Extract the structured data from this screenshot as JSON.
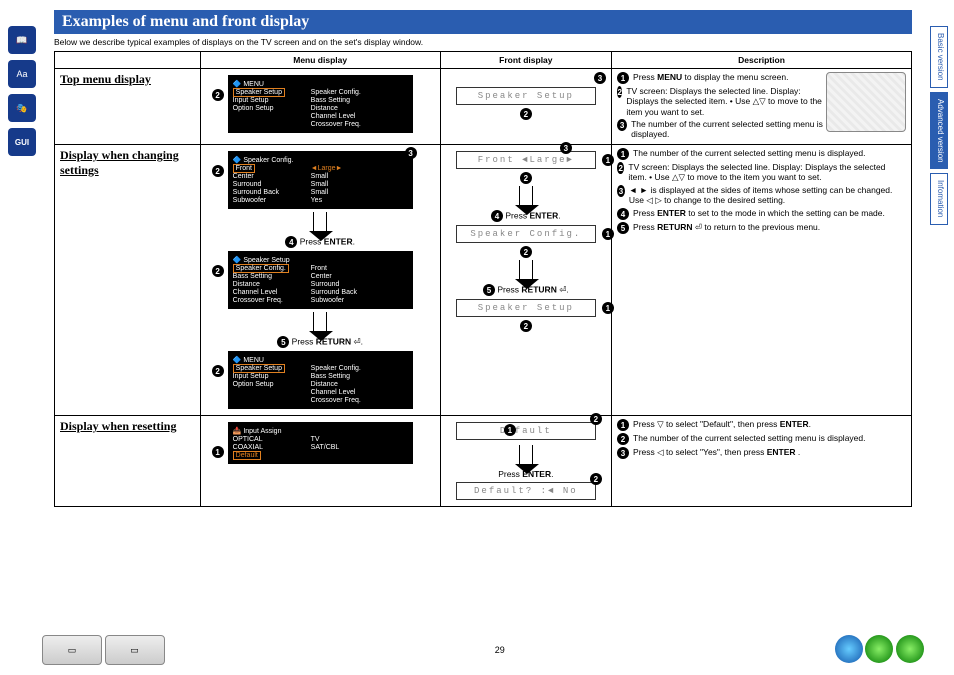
{
  "leftIcons": [
    "book-icon",
    "aa-icon",
    "mask-icon",
    "gui-icon"
  ],
  "rightTabs": [
    {
      "label": "Basic version",
      "active": false
    },
    {
      "label": "Advanced version",
      "active": true
    },
    {
      "label": "Infomation",
      "active": false
    }
  ],
  "title": "Examples of menu and front display",
  "subtitle": "Below we describe typical examples of displays on the TV screen and on the set's display window.",
  "columns": [
    "",
    "Menu display",
    "Front display",
    "Description"
  ],
  "rows": {
    "top": {
      "label": "Top menu display",
      "menu": {
        "title": "MENU",
        "highlight": "Speaker Setup",
        "left": [
          "Speaker Setup",
          "Input Setup",
          "Option Setup"
        ],
        "right": [
          "Speaker Config.",
          "Bass Setting",
          "Distance",
          "Channel Level",
          "Crossover Freq."
        ],
        "bullet": "2"
      },
      "front": {
        "lcd": "Speaker Setup",
        "bullets": [
          "3",
          "2"
        ]
      },
      "desc": [
        {
          "n": "1",
          "t": [
            "Press ",
            {
              "b": "MENU"
            },
            " to display the menu screen."
          ]
        },
        {
          "n": "2",
          "t": [
            "TV screen: Displays the selected line.              Display: Displays the selected item.           • Use △▽ to move to the item you want to set."
          ]
        },
        {
          "n": "3",
          "t": [
            "The number of the current selected setting menu is displayed."
          ]
        }
      ]
    },
    "change": {
      "label": "Display when changing settings",
      "menus": [
        {
          "title": "Speaker Config.",
          "highlight": "Front",
          "bullet": "2",
          "corner": "3",
          "rows": [
            [
              "Front",
              "Large"
            ],
            [
              "Center",
              "Small"
            ],
            [
              "Surround",
              "Small"
            ],
            [
              "Surround Back",
              "Small"
            ],
            [
              "Subwoofer",
              "Yes"
            ]
          ]
        },
        {
          "title": "Speaker Setup",
          "highlight": "Speaker Config.",
          "bullet": "2",
          "rows": [
            [
              "Speaker Config.",
              "Front"
            ],
            [
              "Bass Setting",
              "Center"
            ],
            [
              "Distance",
              "Surround"
            ],
            [
              "Channel Level",
              "Surround Back"
            ],
            [
              "Crossover Freq.",
              "Subwoofer"
            ]
          ]
        },
        {
          "title": "MENU",
          "highlight": "Speaker Setup",
          "bullet": "2",
          "rows": [
            [
              "Speaker Setup",
              "Speaker Config."
            ],
            [
              "Input Setup",
              "Bass Setting"
            ],
            [
              "Option Setup",
              "Distance"
            ],
            [
              "",
              "Channel Level"
            ],
            [
              "",
              "Crossover Freq."
            ]
          ]
        }
      ],
      "steps": [
        {
          "n": "4",
          "t": [
            "Press ",
            {
              "b": "ENTER"
            },
            "."
          ]
        },
        {
          "n": "5",
          "t": [
            "Press ",
            {
              "b": "RETURN"
            },
            " ⏎."
          ]
        }
      ],
      "front": [
        {
          "lcd": "Front  ◄Large►",
          "right": "1",
          "below": "2",
          "corner": "3"
        },
        {
          "step": {
            "n": "4",
            "t": [
              "Press ",
              {
                "b": "ENTER"
              },
              "."
            ]
          }
        },
        {
          "lcd": "Speaker Config.",
          "right": "1",
          "below": "2"
        },
        {
          "step": {
            "n": "5",
            "t": [
              "Press ",
              {
                "b": "RETURN"
              },
              " ⏎."
            ]
          }
        },
        {
          "lcd": "Speaker Setup",
          "right": "1",
          "below": "2"
        }
      ],
      "desc": [
        {
          "n": "1",
          "t": [
            "The number of the current selected setting menu is displayed."
          ]
        },
        {
          "n": "2",
          "t": [
            "TV screen: Displays the selected line.              Display: Displays the selected item.           • Use △▽ to move to the item you want to set."
          ]
        },
        {
          "n": "3",
          "t": [
            "◄ ► is displayed at the sides of items whose setting can be changed. Use ◁ ▷ to change to the desired setting."
          ]
        },
        {
          "n": "4",
          "t": [
            "Press ",
            {
              "b": "ENTER"
            },
            " to set to the mode in which the setting can be made."
          ]
        },
        {
          "n": "5",
          "t": [
            "Press ",
            {
              "b": "RETURN"
            },
            " ⏎ to return to the previous menu."
          ]
        }
      ]
    },
    "reset": {
      "label": "Display when resetting",
      "menu": {
        "title": "Input Assign",
        "bullet": "1",
        "rows": [
          [
            "OPTICAL",
            "TV"
          ],
          [
            "COAXIAL",
            "SAT/CBL"
          ],
          [
            "Default",
            ""
          ]
        ],
        "highlight": "Default"
      },
      "front": [
        {
          "lcd": "Default",
          "left": "1",
          "corner": "2"
        },
        {
          "step": {
            "t": [
              "Press ",
              {
                "b": "ENTER"
              },
              "."
            ]
          }
        },
        {
          "lcd": "Default? :◄ No",
          "corner": "2"
        }
      ],
      "desc": [
        {
          "n": "1",
          "t": [
            "Press ▽ to select \"Default\", then press ",
            {
              "b": "ENTER"
            },
            "."
          ]
        },
        {
          "n": "2",
          "t": [
            "The number of the current selected setting menu is displayed."
          ]
        },
        {
          "n": "3",
          "t": [
            "Press ◁ to select \"Yes\", then press ",
            {
              "b": "ENTER"
            },
            " ."
          ]
        }
      ]
    }
  },
  "pageNumber": "29"
}
